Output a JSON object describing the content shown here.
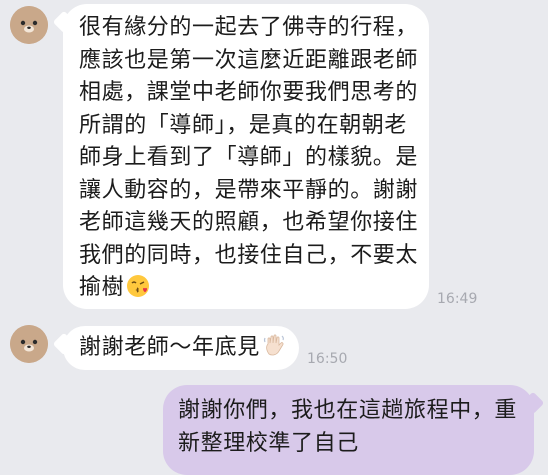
{
  "messages": [
    {
      "sender": "incoming",
      "avatar_icon": "bear-face-icon",
      "lines": [
        "很有緣分的一起去了佛寺的行程，",
        "應該也是第一次這麼近距離跟老師",
        "相處，課堂中老師你要我們思考的",
        "所謂的「導師」，是真的在朝朝老",
        "師身上看到了「導師」的樣貌。是",
        "讓人動容的，是帶來平靜的。謝謝",
        "老師這幾天的照顧，也希望你接住",
        "我們的同時，也接住自己，不要太",
        "揄樹"
      ],
      "trailing_emoji": "kissing-face-with-heart-emoji",
      "time": "16:49"
    },
    {
      "sender": "incoming",
      "avatar_icon": "bear-face-icon",
      "lines": [
        "謝謝老師〜年底見"
      ],
      "trailing_emoji": "waving-hand-emoji",
      "time": "16:50"
    },
    {
      "sender": "outgoing",
      "lines": [
        "謝謝你們，我也在這趟旅程中，重",
        "新整理校準了自己"
      ]
    }
  ],
  "colors": {
    "background": "#e9eaee",
    "incoming_bubble": "#ffffff",
    "outgoing_bubble": "#d8c9ea",
    "timestamp": "#a7a9b0"
  }
}
